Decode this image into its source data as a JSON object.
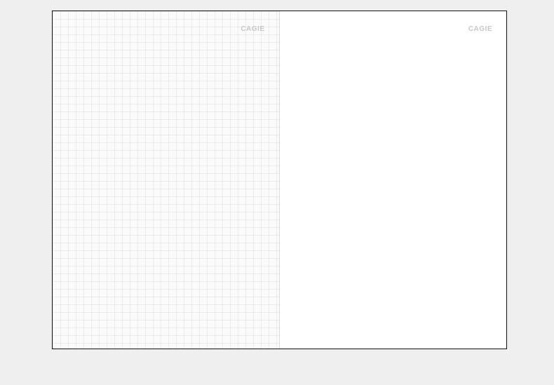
{
  "notebook": {
    "left_page": {
      "brand": "CAGIE"
    },
    "right_page": {
      "brand": "CAGIE"
    }
  }
}
